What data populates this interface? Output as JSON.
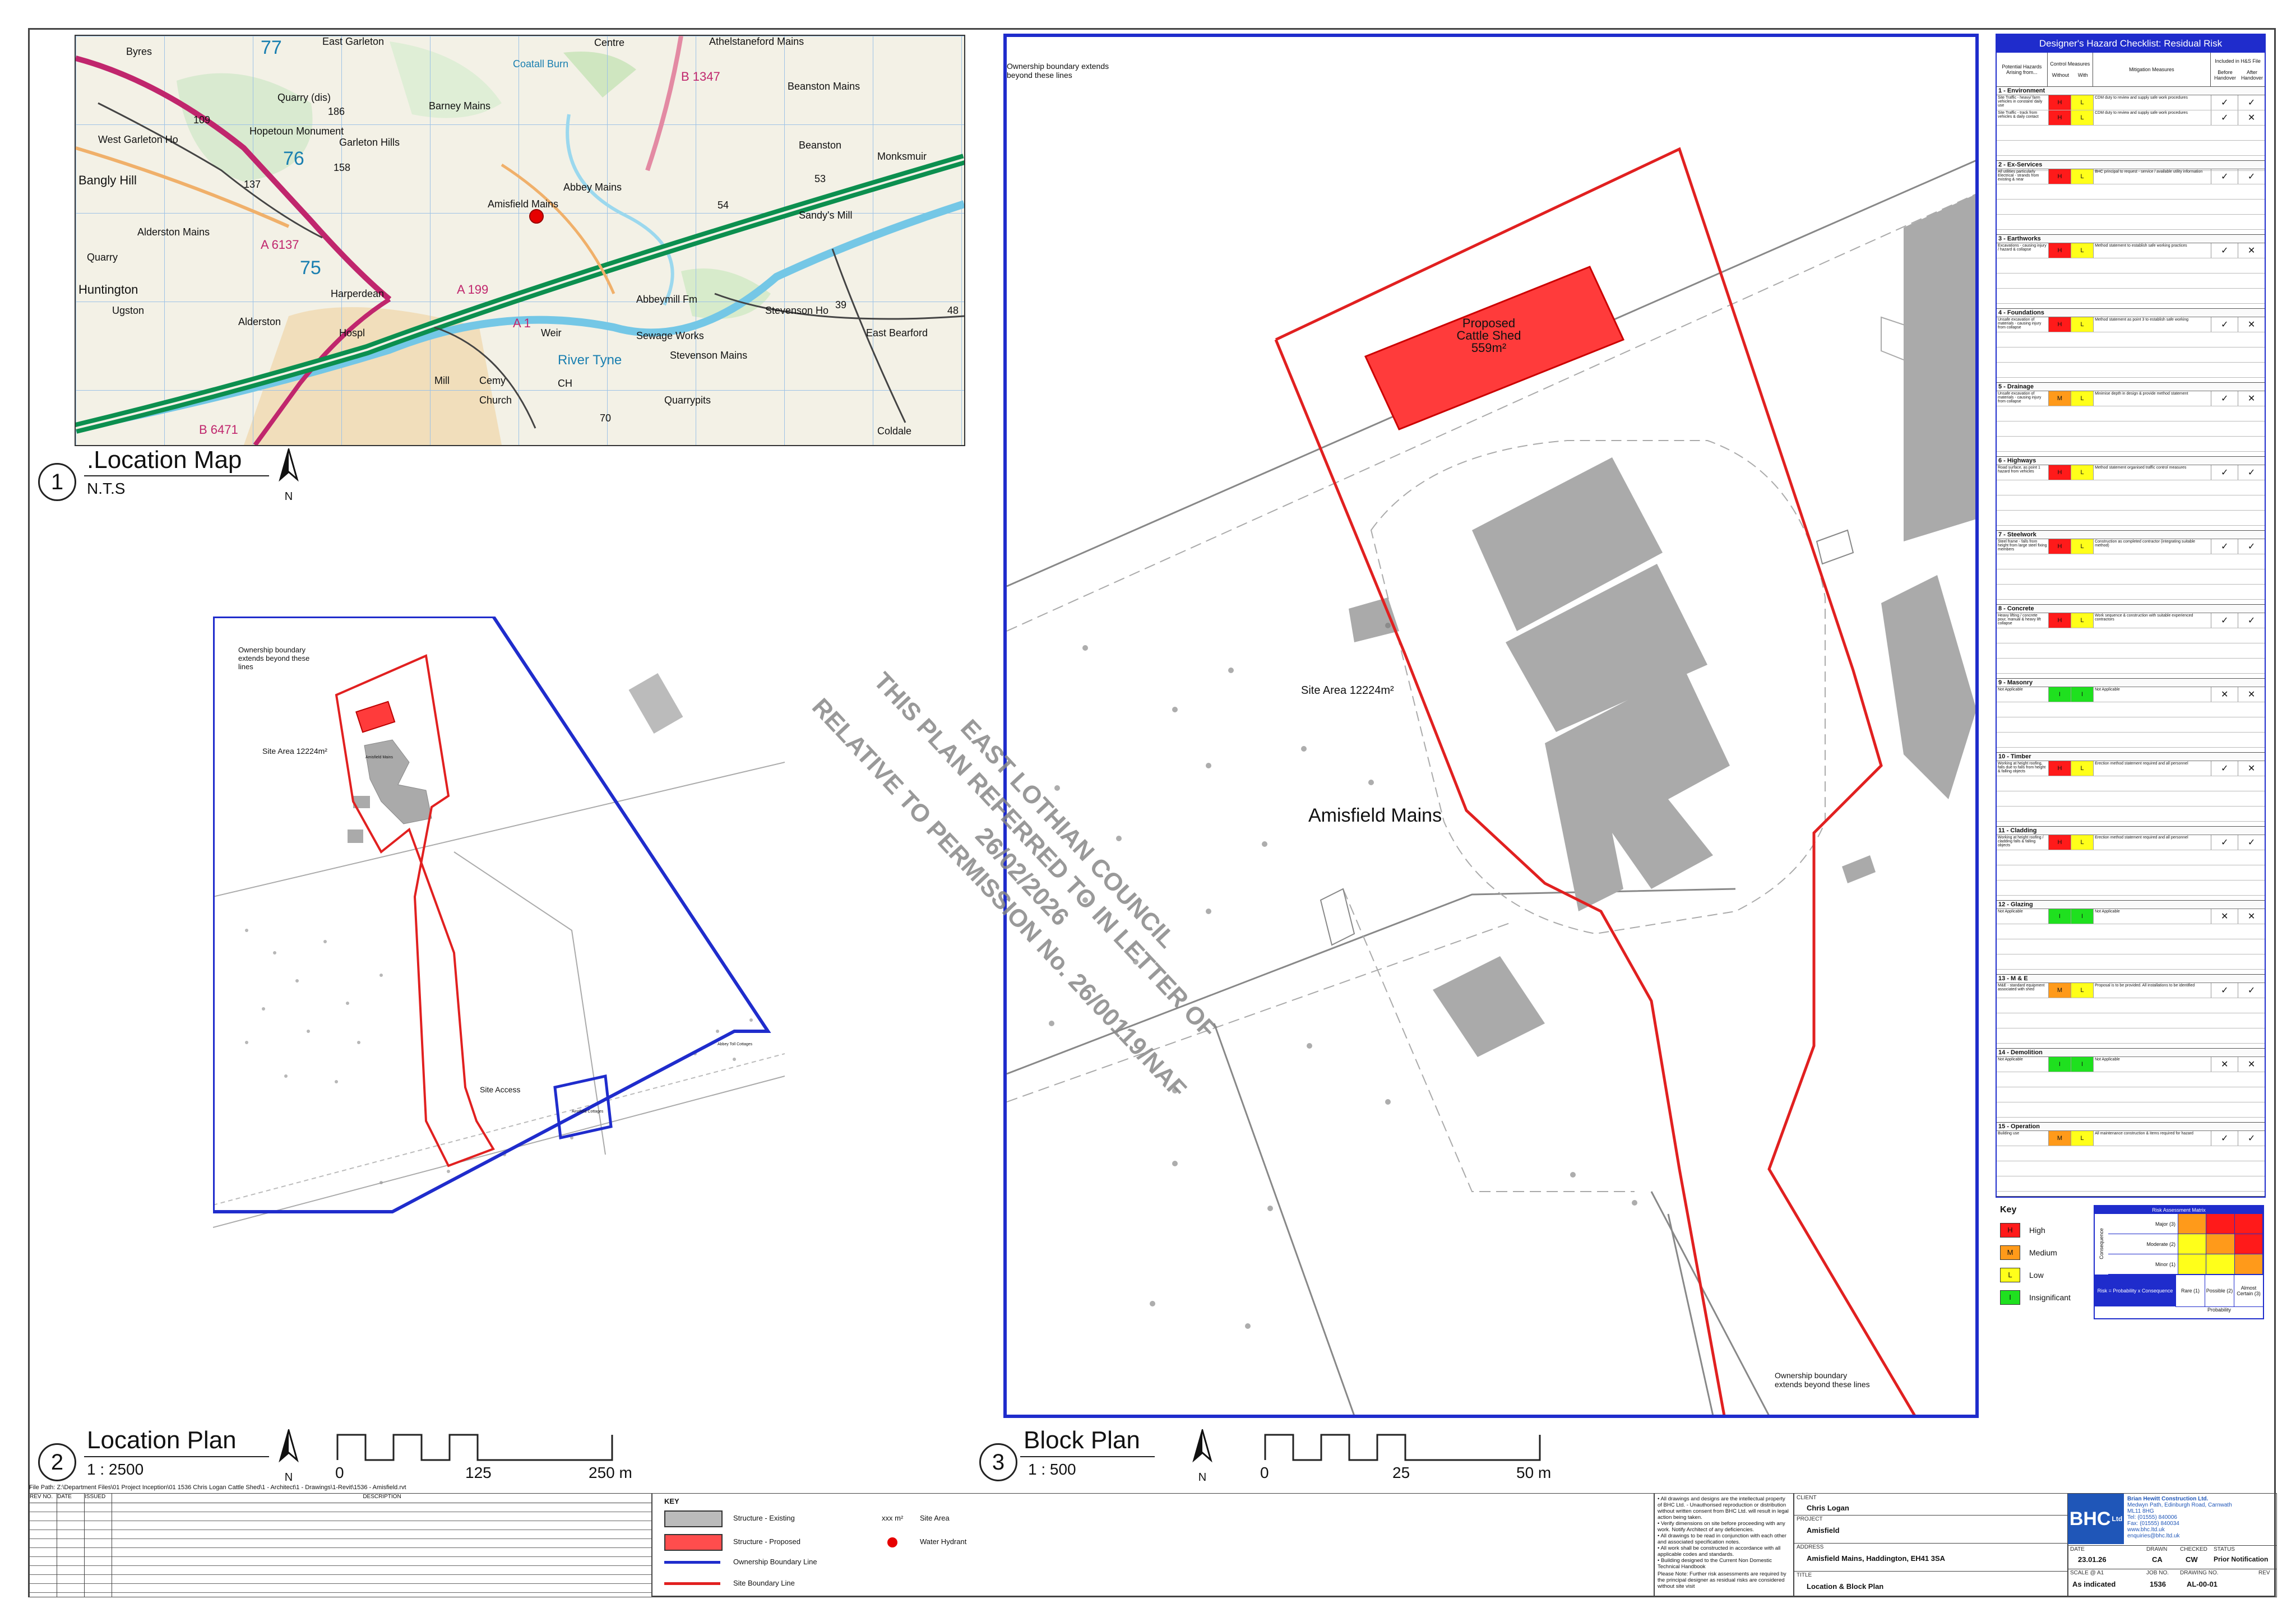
{
  "location_map": {
    "title": ".Location Map",
    "scale": "N.T.S",
    "number": "1",
    "north": "N",
    "labels": [
      "Byres",
      "East Garleton",
      "Centre",
      "Athelstaneford Mains",
      "Coatall Burn",
      "Quarry (dis)",
      "Hopetoun Monument",
      "Garleton Hills",
      "Barney Mains",
      "Beanston Mains",
      "Beanston",
      "Monksmuir",
      "West Garleton Ho",
      "Bangly Hill",
      "Abbey Mains",
      "Amisfield Mains",
      "Sandy's Mill",
      "Alderston Mains",
      "Quarry",
      "Huntington",
      "Ugston",
      "Alderston",
      "Harperdean",
      "Hospl",
      "Weir",
      "Abbeymill Fm",
      "Stevenson Ho",
      "East Bearford",
      "Sewage Works",
      "Stevenson Mains",
      "River Tyne",
      "Mill",
      "Cemy",
      "Church",
      "CH",
      "Quarrypits",
      "Coldale",
      "B 6471",
      "A 199",
      "A 1",
      "B 1347",
      "A 6137",
      "77",
      "76",
      "75",
      "186",
      "158",
      "137",
      "109",
      "54",
      "53",
      "39",
      "48",
      "70"
    ]
  },
  "location_plan": {
    "title": "Location Plan",
    "scale": "1 : 2500",
    "number": "2",
    "north": "N",
    "scalebar": [
      "0",
      "125",
      "250 m"
    ],
    "site_area": "Site Area 12224m²",
    "ownership_note": "Ownership boundary extends beyond these lines",
    "site_access": "Site Access",
    "small_labels": [
      "Amisfield Mains",
      "Ainsfield Cottages",
      "Abbey Toll Cottages"
    ]
  },
  "block_plan": {
    "title": "Block Plan",
    "scale": "1 : 500",
    "number": "3",
    "north": "N",
    "scalebar": [
      "0",
      "25",
      "50 m"
    ],
    "proposed_label": [
      "Proposed",
      "Cattle Shed",
      "559m²"
    ],
    "site_area": "Site Area 12224m²",
    "place_name": "Amisfield Mains",
    "ownership_note_top": "Ownership boundary extends beyond these lines",
    "ownership_note_bottom": "Ownership boundary extends beyond these lines"
  },
  "stamp": {
    "line1": "EAST LOTHIAN COUNCIL",
    "line2": "THIS PLAN REFERRED TO IN LETTER OF",
    "line3": "26/02/2026",
    "line4": "RELATIVE TO PERMISSION No. 26/00119/NAF"
  },
  "hazard_checklist": {
    "title": "Designer's Hazard Checklist: Residual Risk",
    "headers": [
      "Potential Hazards Arising from...",
      "Control Measures",
      "Without",
      "With",
      "Mitigation Measures",
      "Included in H&S File",
      "Before Handover",
      "After Handover"
    ],
    "sections": [
      {
        "title": "1 - Environment",
        "rows": [
          {
            "hazard": "Site Traffic - heavy/ farm vehicles in constant/ daily use",
            "without": "H",
            "with": "L",
            "w_risk": "high",
            "m": "CDM duty to review and supply safe work procedures",
            "b": "✓",
            "a": "✓"
          },
          {
            "hazard": "Site Traffic - track from vehicles & daily contact",
            "without": "H",
            "with": "L",
            "w_risk": "high",
            "m": "CDM duty to review and supply safe work procedures",
            "b": "✓",
            "a": "✕"
          }
        ]
      },
      {
        "title": "2 - Ex-Services",
        "rows": [
          {
            "hazard": "All utilities particularly Electrical - strands from existing & near",
            "without": "H",
            "with": "L",
            "w_risk": "high",
            "m": "BHC principal to request - service / available utility information",
            "b": "✓",
            "a": "✓"
          }
        ]
      },
      {
        "title": "3 - Earthworks",
        "rows": [
          {
            "hazard": "Excavations - causing injury / hazard & collapse",
            "without": "H",
            "with": "L",
            "w_risk": "high",
            "m": "Method statement to establish safe working practices",
            "b": "✓",
            "a": "✕"
          }
        ]
      },
      {
        "title": "4 - Foundations",
        "rows": [
          {
            "hazard": "Unsafe excavation of materials - causing injury from collapse",
            "without": "H",
            "with": "L",
            "w_risk": "high",
            "m": "Method statement as point 3 to establish safe working",
            "b": "✓",
            "a": "✕"
          }
        ]
      },
      {
        "title": "5 - Drainage",
        "rows": [
          {
            "hazard": "Unsafe excavation of materials - causing injury from collapse",
            "without": "M",
            "with": "L",
            "w_risk": "med",
            "m": "Minimise depth in design & provide method statement",
            "b": "✓",
            "a": "✕"
          }
        ]
      },
      {
        "title": "6 - Highways",
        "rows": [
          {
            "hazard": "Road surface, as point 1 hazard from vehicles",
            "without": "H",
            "with": "L",
            "w_risk": "high",
            "m": "Method statement organised traffic control measures",
            "b": "✓",
            "a": "✓"
          }
        ]
      },
      {
        "title": "7 - Steelwork",
        "rows": [
          {
            "hazard": "Steel frame - falls from height from large steel fixing members",
            "without": "H",
            "with": "L",
            "w_risk": "high",
            "m": "Construction as completed contractor (integrating suitable method)",
            "b": "✓",
            "a": "✓"
          }
        ]
      },
      {
        "title": "8 - Concrete",
        "rows": [
          {
            "hazard": "Heavy lifting / concrete pour, manual & heavy lift collapse",
            "without": "H",
            "with": "L",
            "w_risk": "high",
            "m": "Work sequence & construction with suitable experienced contractors",
            "b": "✓",
            "a": "✓"
          }
        ]
      },
      {
        "title": "9 - Masonry",
        "rows": [
          {
            "hazard": "Not Applicable",
            "without": "I",
            "with": "I",
            "w_risk": "ins",
            "m": "Not Applicable",
            "b": "✕",
            "a": "✕"
          }
        ]
      },
      {
        "title": "10 - Timber",
        "rows": [
          {
            "hazard": "Working at height roofing, falls due to falls from height & falling objects",
            "without": "H",
            "with": "L",
            "w_risk": "high",
            "m": "Erection method statement required and all personnel",
            "b": "✓",
            "a": "✕"
          }
        ]
      },
      {
        "title": "11 - Cladding",
        "rows": [
          {
            "hazard": "Working at height roofing / cladding falls & falling objects",
            "without": "H",
            "with": "L",
            "w_risk": "high",
            "m": "Erection method statement required and all personnel",
            "b": "✓",
            "a": "✓"
          }
        ]
      },
      {
        "title": "12 - Glazing",
        "rows": [
          {
            "hazard": "Not Applicable",
            "without": "I",
            "with": "I",
            "w_risk": "ins",
            "m": "Not Applicable",
            "b": "✕",
            "a": "✕"
          }
        ]
      },
      {
        "title": "13 - M & E",
        "rows": [
          {
            "hazard": "M&E - standard equipment associated with shed",
            "without": "M",
            "with": "L",
            "w_risk": "med",
            "m": "Proposal is to be provided. All installations to be identified",
            "b": "✓",
            "a": "✓"
          }
        ]
      },
      {
        "title": "14 - Demolition",
        "rows": [
          {
            "hazard": "Not Applicable",
            "without": "I",
            "with": "I",
            "w_risk": "ins",
            "m": "Not Applicable",
            "b": "✕",
            "a": "✕"
          }
        ]
      },
      {
        "title": "15 - Operation",
        "rows": [
          {
            "hazard": "Building use",
            "without": "M",
            "with": "L",
            "w_risk": "med",
            "m": "All maintenance construction & items required for hazard",
            "b": "✓",
            "a": "✓"
          }
        ]
      }
    ]
  },
  "risk_key": {
    "title": "Key",
    "items": [
      {
        "code": "H",
        "label": "High",
        "color": "#ff1a1a"
      },
      {
        "code": "M",
        "label": "Medium",
        "color": "#ff9a1a"
      },
      {
        "code": "L",
        "label": "Low",
        "color": "#ffff1a"
      },
      {
        "code": "I",
        "label": "Insignificant",
        "color": "#1fe01f"
      }
    ]
  },
  "risk_matrix": {
    "title": "Risk Assessment Matrix",
    "consequence_label": "Consequence",
    "rows": [
      "Major (3)",
      "Moderate (2)",
      "Minor (1)"
    ],
    "cols": [
      "Rare (1)",
      "Possible (2)",
      "Almost Certain (3)"
    ],
    "probability_label": "Probability",
    "formula": "Risk = Probability x Consequence"
  },
  "legend": {
    "title": "KEY",
    "items": [
      "Structure - Existing",
      "Structure - Proposed",
      "Ownership Boundary Line",
      "Site Boundary Line"
    ],
    "site_area_symbol": "xxx m²",
    "site_area_label": "Site Area",
    "hydrant_label": "Water Hydrant"
  },
  "revision_table": {
    "headers": [
      "REV NO.",
      "DATE",
      "ISSUED",
      "DESCRIPTION"
    ]
  },
  "file_path": "File Path:  Z:\\Department Files\\01 Project Inception\\01 1536 Chris Logan Cattle Shed\\1 - Architect\\1 - Drawings\\1-Revit\\1536 - Amisfield.rvt",
  "notes": [
    "All drawings and designs are the intellectual property of BHC Ltd. - Unauthorised reproduction or distribution without written consent from BHC Ltd. will result in legal action being taken.",
    "Verify dimensions on site before proceeding with any work. Notify Architect of any deficiencies.",
    "All drawings to be read in conjunction with each other and associated specification notes.",
    "All work shall be constructed in accordance with all applicable codes and standards.",
    "Building designed to the Current Non Domestic Technical Handbook"
  ],
  "notes_please": "Please Note: Further risk assessments are required by the principal designer as residual risks are considered without site visit",
  "title_block": {
    "client_label": "CLIENT",
    "client": "Chris Logan",
    "project_label": "PROJECT",
    "project": "Amisfield",
    "address_label": "ADDRESS",
    "address": "Amisfield Mains, Haddington, EH41 3SA",
    "title_label": "TITLE",
    "title": "Location & Block Plan",
    "date_label": "DATE",
    "date": "23.01.26",
    "drawn_label": "DRAWN",
    "drawn": "CA",
    "checked_label": "CHECKED",
    "checked": "CW",
    "status_label": "STATUS",
    "status": "Prior Notification",
    "scale_label": "SCALE @ A1",
    "scale": "As indicated",
    "job_label": "JOB NO.",
    "job": "1536",
    "drawing_label": "DRAWING NO.",
    "drawing": "AL-00-01",
    "rev_label": "REV",
    "company_logo": "BHC",
    "company_logo_suffix": "Ltd",
    "company_name": "Brian Hewitt Construction Ltd.",
    "company_address": [
      "Medwyn Path, Edinburgh Road, Carnwath",
      "ML11 8HG",
      "Tel: (01555) 840006",
      "Fax: (01555) 840034",
      "www.bhc.ltd.uk",
      "enquiries@bhc.ltd.uk"
    ]
  }
}
